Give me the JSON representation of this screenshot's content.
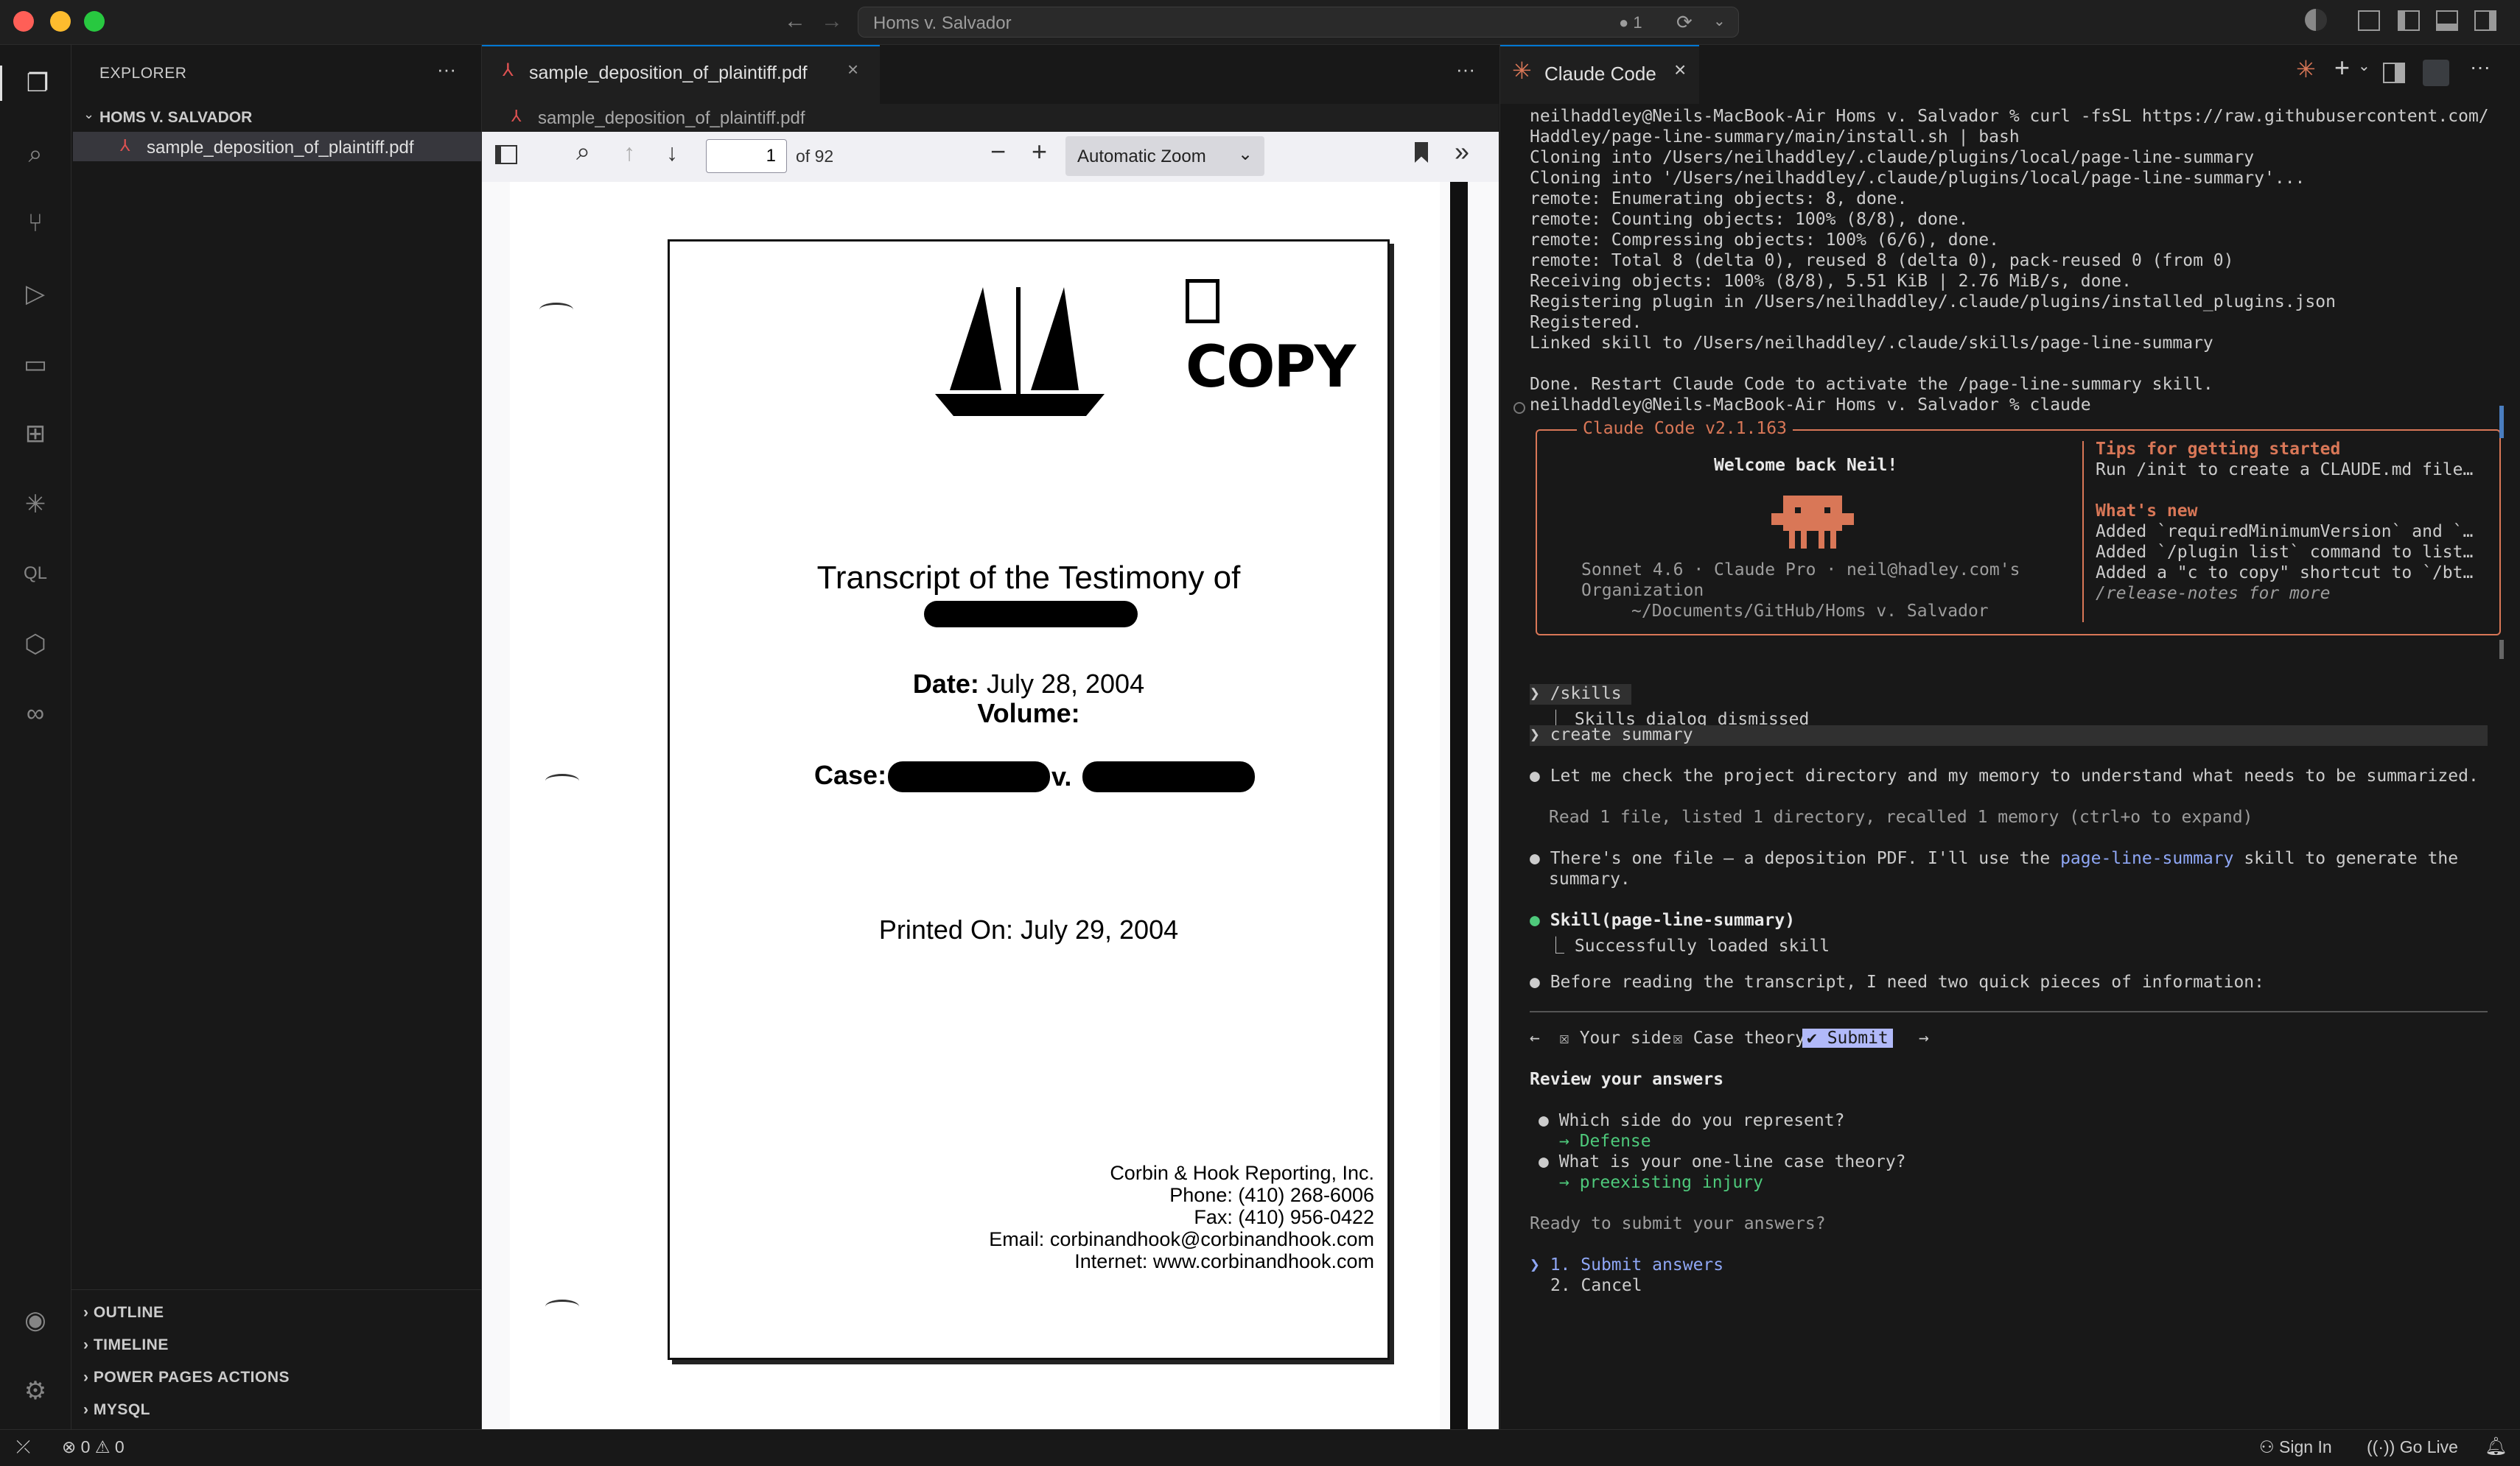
{
  "titlebar": {
    "search_text": "Homs v. Salvador",
    "problems_count": "1",
    "colors": {
      "close": "#ff5f57",
      "minimize": "#febc2e",
      "maximize": "#28c840"
    }
  },
  "sidebar": {
    "title": "EXPLORER",
    "folder": "HOMS V. SALVADOR",
    "file": "sample_deposition_of_plaintiff.pdf",
    "sections": [
      "OUTLINE",
      "TIMELINE",
      "POWER PAGES ACTIONS",
      "MYSQL"
    ]
  },
  "editor": {
    "tab_label": "sample_deposition_of_plaintiff.pdf",
    "breadcrumb": "sample_deposition_of_plaintiff.pdf",
    "pdf_toolbar": {
      "page_input": "1",
      "page_total": "of 92",
      "zoom": "Automatic Zoom"
    },
    "document": {
      "stamp": "COPY",
      "title": "Transcript of the Testimony of",
      "date_label": "Date:",
      "date_value": "July 28, 2004",
      "volume_label": "Volume:",
      "case_label": "Case:",
      "case_v": "v.",
      "printed": "Printed On: July 29, 2004",
      "reporter": [
        "Corbin & Hook Reporting, Inc.",
        "Phone: (410) 268-6006",
        "Fax: (410) 956-0422",
        "Email: corbinandhook@corbinandhook.com",
        "Internet: www.corbinandhook.com"
      ]
    }
  },
  "panel": {
    "tab_label": "Claude Code",
    "terminal_lines": [
      "neilhaddley@Neils-MacBook-Air Homs v. Salvador % curl -fsSL https://raw.githubusercontent.com/",
      "Haddley/page-line-summary/main/install.sh | bash",
      "Cloning into /Users/neilhaddley/.claude/plugins/local/page-line-summary",
      "Cloning into '/Users/neilhaddley/.claude/plugins/local/page-line-summary'...",
      "remote: Enumerating objects: 8, done.",
      "remote: Counting objects: 100% (8/8), done.",
      "remote: Compressing objects: 100% (6/6), done.",
      "remote: Total 8 (delta 0), reused 8 (delta 0), pack-reused 0 (from 0)",
      "Receiving objects: 100% (8/8), 5.51 KiB | 2.76 MiB/s, done.",
      "Registering plugin in /Users/neilhaddley/.claude/plugins/installed_plugins.json",
      "Registered.",
      "Linked skill to /Users/neilhaddley/.claude/skills/page-line-summary",
      "",
      "Done. Restart Claude Code to activate the /page-line-summary skill."
    ],
    "prompt_line": "neilhaddley@Neils-MacBook-Air Homs v. Salvador % claude",
    "welcome_box": {
      "version": "Claude Code v2.1.163",
      "welcome": "Welcome back Neil!",
      "model_line": "Sonnet 4.6 · Claude Pro · neil@hadley.com's",
      "org": "Organization",
      "path": "~/Documents/GitHub/Homs v. Salvador",
      "tips_title": "Tips for getting started",
      "tips_line": "Run /init to create a CLAUDE.md file…",
      "whats_new_title": "What's new",
      "news": [
        "Added `requiredMinimumVersion` and `…",
        "Added `/plugin list` command to list…",
        "Added a \"c to copy\" shortcut to `/bt…"
      ],
      "release_notes": "/release-notes for more"
    },
    "conversation": {
      "cmd1": "/skills",
      "cmd1_result": "Skills dialog dismissed",
      "cmd2": "create summary",
      "msg1": "Let me check the project directory and my memory to understand what needs to be summarized.",
      "read_line": "Read 1 file, listed 1 directory, recalled 1 memory (ctrl+o to expand)",
      "msg2a": "There's one file — a deposition PDF. I'll use the ",
      "msg2_link": "page-line-summary",
      "msg2b": " skill to generate the",
      "msg2c": "summary.",
      "skill_call": "Skill(page-line-summary)",
      "skill_result": "Successfully loaded skill",
      "msg3": "Before reading the transcript, I need two quick pieces of information:"
    },
    "question_tabs": {
      "left_arrow": "←",
      "tab1": "☒ Your side",
      "tab2": "☒ Case theory",
      "tab3": "✔ Submit",
      "right_arrow": "→"
    },
    "review": {
      "heading": "Review your answers",
      "q1": "Which side do you represent?",
      "a1": "→ Defense",
      "q2": "What is your one-line case theory?",
      "a2": "→ preexisting injury",
      "ready": "Ready to submit your answers?",
      "opt1": "1. Submit answers",
      "opt2": "2. Cancel"
    }
  },
  "statusbar": {
    "errors": "0",
    "warnings": "0",
    "sign_in": "Sign In",
    "go_live": "Go Live"
  }
}
